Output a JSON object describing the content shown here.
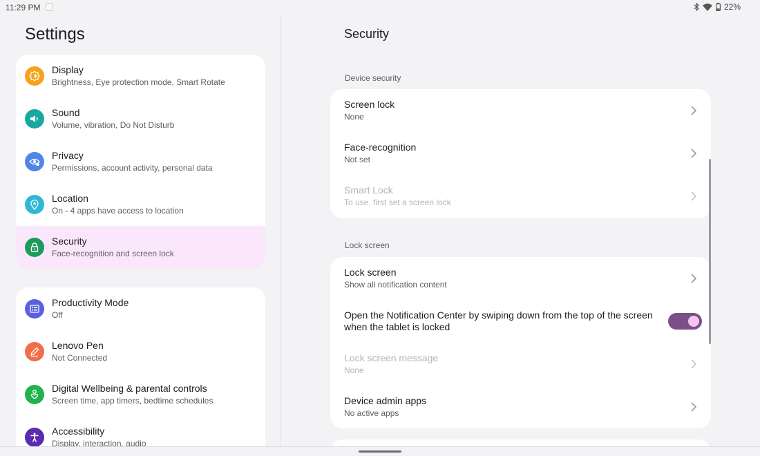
{
  "status_bar": {
    "time": "11:29 PM",
    "battery": "22%",
    "icons": [
      "bluetooth-icon",
      "wifi-icon",
      "battery-icon"
    ]
  },
  "left": {
    "title": "Settings",
    "group_a": [
      {
        "title": "Display",
        "subtitle": "Brightness, Eye protection mode, Smart Rotate",
        "icon": "display-icon",
        "color": "#f6a21b"
      },
      {
        "title": "Sound",
        "subtitle": "Volume, vibration, Do Not Disturb",
        "icon": "sound-icon",
        "color": "#17a8a0"
      },
      {
        "title": "Privacy",
        "subtitle": "Permissions, account activity, personal data",
        "icon": "privacy-icon",
        "color": "#4f86e8"
      },
      {
        "title": "Location",
        "subtitle": "On - 4 apps have access to location",
        "icon": "location-icon",
        "color": "#2fb8d6"
      },
      {
        "title": "Security",
        "subtitle": "Face-recognition and screen lock",
        "icon": "lock-icon",
        "color": "#1e9a5a",
        "selected": true
      }
    ],
    "group_b": [
      {
        "title": "Productivity Mode",
        "subtitle": "Off",
        "icon": "productivity-icon",
        "color": "#5b5fe0"
      },
      {
        "title": "Lenovo Pen",
        "subtitle": "Not Connected",
        "icon": "pen-icon",
        "color": "#f06e4a"
      },
      {
        "title": "Digital Wellbeing & parental controls",
        "subtitle": "Screen time, app timers, bedtime schedules",
        "icon": "wellbeing-icon",
        "color": "#22b24c"
      },
      {
        "title": "Accessibility",
        "subtitle": "Display, interaction, audio",
        "icon": "accessibility-icon",
        "color": "#5b2bb0"
      }
    ]
  },
  "right": {
    "title": "Security",
    "sections": [
      {
        "label": "Device security",
        "rows": [
          {
            "title": "Screen lock",
            "subtitle": "None",
            "disabled": false
          },
          {
            "title": "Face-recognition",
            "subtitle": "Not set",
            "disabled": false
          },
          {
            "title": "Smart Lock",
            "subtitle": "To use, first set a screen lock",
            "disabled": true
          }
        ]
      },
      {
        "label": "Lock screen",
        "rows": [
          {
            "title": "Lock screen",
            "subtitle": "Show all notification content",
            "disabled": false
          },
          {
            "title": "Open the Notification Center by swiping down from the top of the screen when the tablet is locked",
            "toggle": true,
            "toggle_on": true
          },
          {
            "title": "Lock screen message",
            "subtitle": "None",
            "disabled": true
          },
          {
            "title": "Device admin apps",
            "subtitle": "No active apps",
            "disabled": false
          }
        ]
      }
    ]
  },
  "colors": {
    "background": "#f3f2f4",
    "selected_item": "#fbe7fb",
    "toggle_track": "#7b4f87",
    "toggle_knob": "#f3c6f5"
  }
}
